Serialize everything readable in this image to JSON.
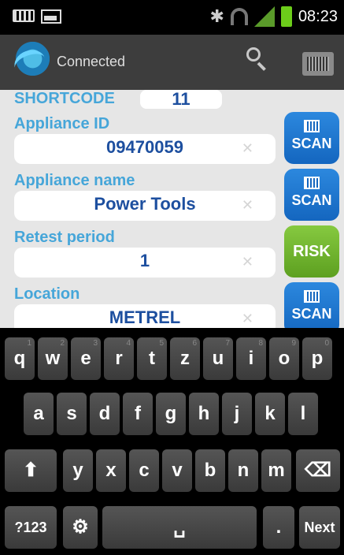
{
  "status_bar": {
    "time": "08:23",
    "icons": [
      "keyboard-icon",
      "image-icon",
      "bluetooth-icon",
      "wifi-icon",
      "signal-icon",
      "battery-icon"
    ]
  },
  "action_bar": {
    "status": "Connected",
    "icons": [
      "app-logo-icon",
      "search-icon",
      "barcode-icon"
    ]
  },
  "form": {
    "shortcode": {
      "label": "SHORTCODE",
      "value": "11"
    },
    "appliance_id": {
      "label": "Appliance ID",
      "value": "09470059",
      "button": "SCAN"
    },
    "appliance_name": {
      "label": "Appliance name",
      "value": "Power Tools",
      "button": "SCAN"
    },
    "retest_period": {
      "label": "Retest period",
      "value": "1",
      "button": "RISK"
    },
    "location": {
      "label": "Location",
      "value": "METREL",
      "button": "SCAN"
    }
  },
  "keyboard": {
    "row1": [
      {
        "label": "q",
        "hint": "1"
      },
      {
        "label": "w",
        "hint": "2"
      },
      {
        "label": "e",
        "hint": "3"
      },
      {
        "label": "r",
        "hint": "4"
      },
      {
        "label": "t",
        "hint": "5"
      },
      {
        "label": "z",
        "hint": "6"
      },
      {
        "label": "u",
        "hint": "7"
      },
      {
        "label": "i",
        "hint": "8"
      },
      {
        "label": "o",
        "hint": "9"
      },
      {
        "label": "p",
        "hint": "0"
      }
    ],
    "row2": [
      "a",
      "s",
      "d",
      "f",
      "g",
      "h",
      "j",
      "k",
      "l"
    ],
    "row3": [
      "y",
      "x",
      "c",
      "v",
      "b",
      "n",
      "m"
    ],
    "shift": "⬆",
    "backspace": "⌫",
    "symbols": "?123",
    "settings": "⚙",
    "space": "␣",
    "period": ".",
    "next": "Next"
  },
  "colors": {
    "label_blue": "#46a6d9",
    "value_blue": "#1d4f9f",
    "scan_blue": "#1e74cf",
    "risk_green": "#6fb52e"
  }
}
